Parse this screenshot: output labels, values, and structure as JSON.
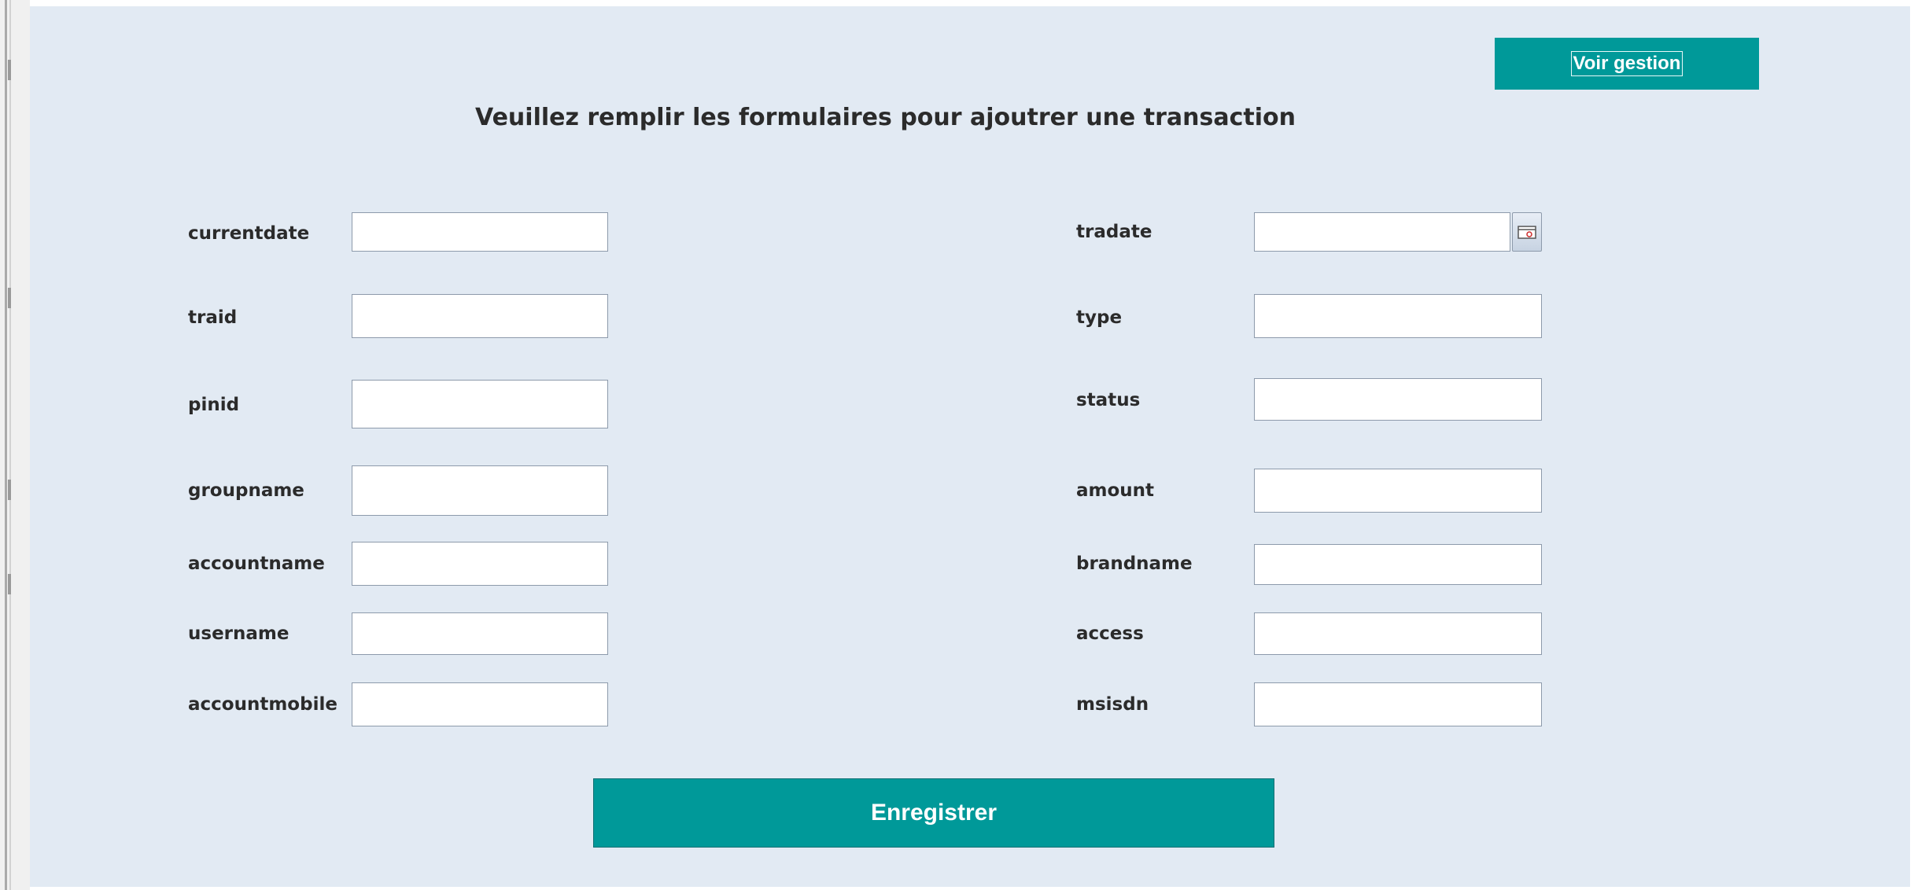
{
  "header": {
    "title": "Veuillez remplir les formulaires pour ajoutrer une transaction",
    "view_button_label": "Voir gestion"
  },
  "form": {
    "left_fields": [
      {
        "label": "currentdate",
        "value": ""
      },
      {
        "label": "traid",
        "value": ""
      },
      {
        "label": "pinid",
        "value": ""
      },
      {
        "label": "groupname",
        "value": ""
      },
      {
        "label": "accountname",
        "value": ""
      },
      {
        "label": "username",
        "value": ""
      },
      {
        "label": "accountmobile",
        "value": ""
      }
    ],
    "right_fields": [
      {
        "label": "tradate",
        "value": ""
      },
      {
        "label": "type",
        "value": ""
      },
      {
        "label": "status",
        "value": ""
      },
      {
        "label": "amount",
        "value": ""
      },
      {
        "label": "brandname",
        "value": ""
      },
      {
        "label": "access",
        "value": ""
      },
      {
        "label": "msisdn",
        "value": ""
      }
    ],
    "date_picker_icon": "calendar-icon",
    "submit_label": "Enregistrer"
  },
  "colors": {
    "accent": "#009999",
    "panel_background": "#e2eaf3",
    "label_text": "#2b2b2b"
  }
}
